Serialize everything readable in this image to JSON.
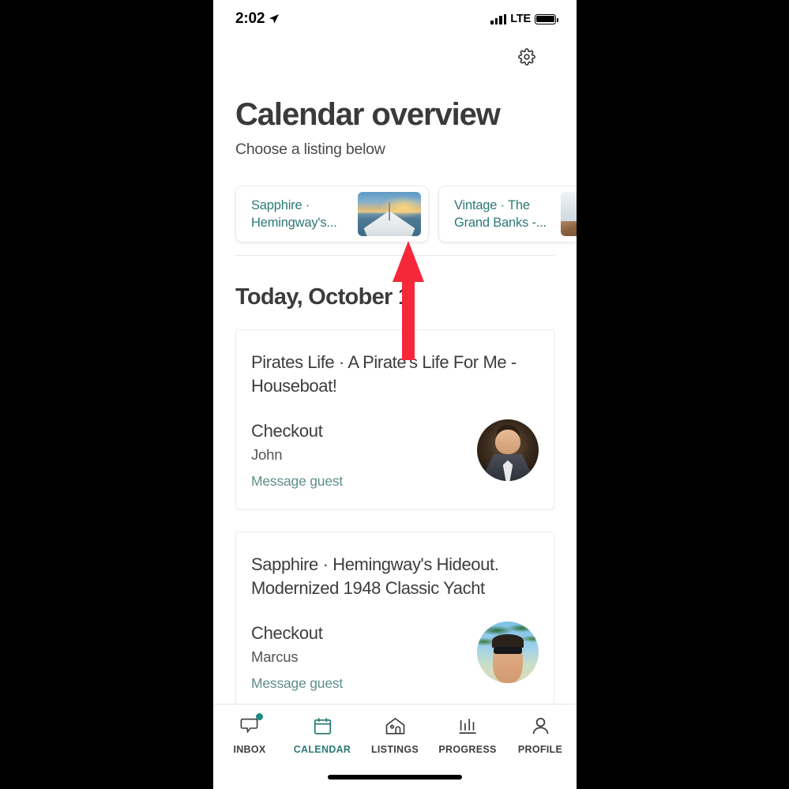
{
  "status_bar": {
    "time": "2:02",
    "location_icon": "location-arrow-icon",
    "signal_icon": "signal-bars-icon",
    "network": "LTE",
    "battery_icon": "battery-full-icon"
  },
  "header": {
    "settings_icon": "gear-icon",
    "title": "Calendar overview",
    "subtitle": "Choose a listing below"
  },
  "listings": [
    {
      "name": "Sapphire · Hemingway's...",
      "thumb": "boat-sunset-thumbnail"
    },
    {
      "name": "Vintage · The Grand Banks -...",
      "thumb": "yacht-interior-thumbnail"
    }
  ],
  "today_heading": "Today, October 1",
  "reservations": [
    {
      "title": "Pirates Life · A Pirate's Life For Me - Houseboat!",
      "status": "Checkout",
      "guest": "John",
      "action": "Message guest",
      "avatar": "guest-avatar-john"
    },
    {
      "title": "Sapphire · Hemingway's Hideout. Modernized 1948 Classic Yacht",
      "status": "Checkout",
      "guest": "Marcus",
      "action": "Message guest",
      "avatar": "guest-avatar-marcus"
    }
  ],
  "tabs": [
    {
      "label": "INBOX",
      "icon": "chat-bubble-icon",
      "active": false,
      "badge": true
    },
    {
      "label": "CALENDAR",
      "icon": "calendar-icon",
      "active": true,
      "badge": false
    },
    {
      "label": "LISTINGS",
      "icon": "house-icon",
      "active": false,
      "badge": false
    },
    {
      "label": "PROGRESS",
      "icon": "bar-chart-icon",
      "active": false,
      "badge": false
    },
    {
      "label": "PROFILE",
      "icon": "person-icon",
      "active": false,
      "badge": false
    }
  ],
  "annotation": {
    "arrow_icon": "red-up-arrow-annotation",
    "color": "#F5283A"
  },
  "colors": {
    "accent_teal": "#2C7A76",
    "text_dark": "#3D3D3D",
    "link_muted": "#5F8D8B",
    "annotation_red": "#F5283A"
  }
}
